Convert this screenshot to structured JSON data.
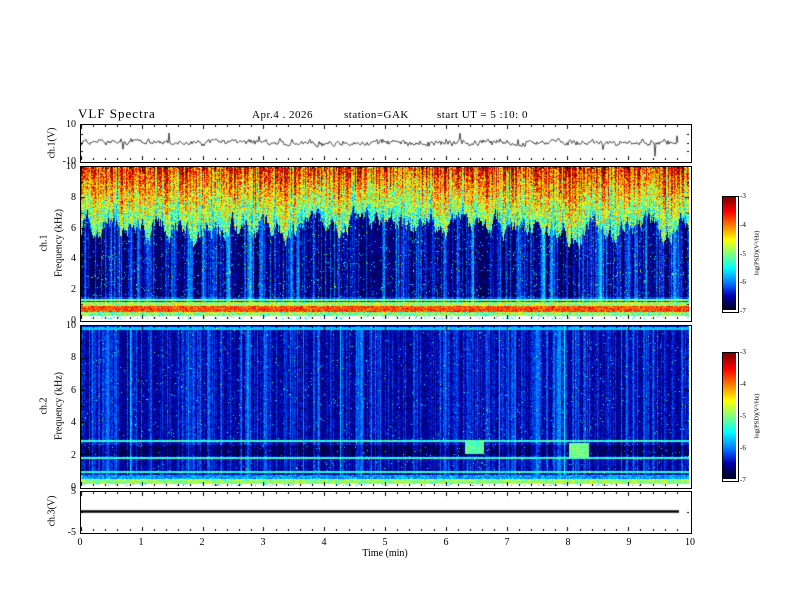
{
  "title": "VLF Spectra",
  "header": {
    "date": "Apr.4 . 2026",
    "station": "station=GAK",
    "start_ut": "start UT =  5 :10: 0"
  },
  "xaxis": {
    "label": "Time (min)",
    "ticks": [
      0,
      1,
      2,
      3,
      4,
      5,
      6,
      7,
      8,
      9,
      10
    ],
    "range": [
      0,
      10
    ]
  },
  "chart_data": [
    {
      "type": "line",
      "name": "ch1-waveform",
      "ylabel": "ch.1(V)",
      "ylim": [
        -10,
        10
      ],
      "yticks": [
        10,
        -10
      ],
      "xlim": [
        0,
        10
      ],
      "x_extent": [
        0,
        9.8
      ],
      "description": "Broadband noisy voltage trace centered on 0 V, typical excursions of ±2-3 V with sparse spikes reaching about -8 V"
    },
    {
      "type": "heatmap",
      "name": "ch1-spectrogram",
      "channel": "ch.1",
      "ylabel": "Frequency (kHz)",
      "ylim": [
        0,
        10
      ],
      "yticks": [
        0,
        2,
        4,
        6,
        8,
        10
      ],
      "xlim": [
        0,
        10
      ],
      "zlim": [
        -7,
        -3
      ],
      "colorbar": {
        "label": "log(PSD)(V²/Hz)",
        "ticks": [
          -3,
          -4,
          -5,
          -6,
          -7
        ],
        "range": [
          -7,
          -3
        ]
      },
      "features": [
        "intense broadband emission above ~5-7 kHz (PSD ≈ -4.5 to -3, green/yellow/red) with jagged lower edge",
        "dark background (~-7) from ~1.5 to 6 kHz crossed by dense vertical broadband impulse streaks",
        "strong narrowband red/orange line near 0.5-0.9 kHz (PSD ≈ -3.5)",
        "green narrowband lines near 1.0 and 1.3 kHz (PSD ≈ -5)",
        "green band 0.3-0.5 kHz, no data (white) below ~0.2 kHz"
      ]
    },
    {
      "type": "heatmap",
      "name": "ch2-spectrogram",
      "channel": "ch.2",
      "ylabel": "Frequency (kHz)",
      "ylim": [
        0,
        10
      ],
      "yticks": [
        0,
        2,
        4,
        6,
        8,
        10
      ],
      "xlim": [
        0,
        10
      ],
      "zlim": [
        -7,
        -3
      ],
      "colorbar": {
        "label": "log(PSD)(V²/Hz)",
        "ticks": [
          -3,
          -4,
          -5,
          -6,
          -7
        ],
        "range": [
          -7,
          -3
        ]
      },
      "features": [
        "dark blue background near -7 over the whole band with vertical broadband impulse streaks",
        "thin green narrowband lines near 0.9, 1.8 and 2.8 kHz (PSD ≈ -5.5)",
        "nearly black quiet band between ~2 and 2.6 kHz",
        "green/yellow band 0.2-0.5 kHz (PSD ≈ -5), no data (white) below ~0.15 kHz",
        "cyan emission patches near 6.5 min and 8.2 min at 2-3 kHz"
      ]
    },
    {
      "type": "line",
      "name": "ch3-waveform",
      "ylabel": "ch.3(V)",
      "ylim": [
        -5,
        5
      ],
      "yticks": [
        5,
        -5
      ],
      "xlim": [
        0,
        10
      ],
      "x_extent": [
        0,
        9.8
      ],
      "description": "Constant 0 V thick flat trace"
    }
  ],
  "colors": {
    "axis": "#000000",
    "background": "#ffffff",
    "colormap": "jet (dark blue -7 → blue → cyan → green → yellow → red -3)"
  }
}
